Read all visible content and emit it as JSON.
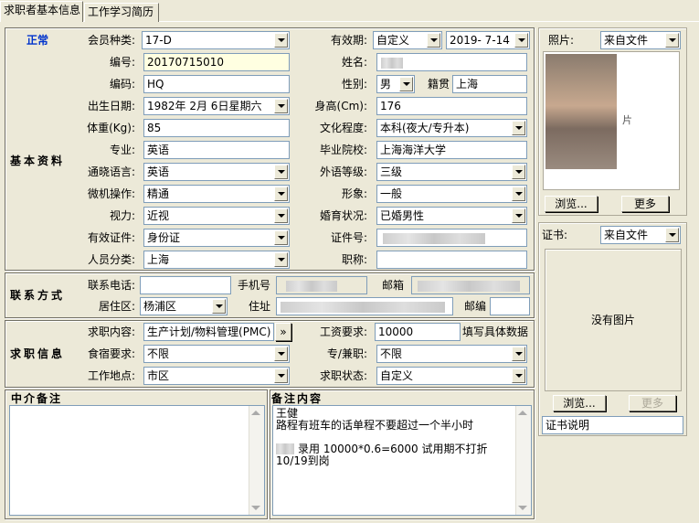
{
  "tabs": [
    "求职者基本信息",
    "工作学习简历"
  ],
  "status": "正常",
  "member_type": {
    "label": "会员种类:",
    "value": "17-D"
  },
  "validity": {
    "label": "有效期:",
    "value": "自定义",
    "date": "2019- 7-14"
  },
  "sections": {
    "basic": "基本资料",
    "contact": "联系方式",
    "job": "求职信息",
    "agent_note": "中介备注",
    "note": "备注内容"
  },
  "basic": {
    "number": {
      "label": "编号:",
      "value": "20170715010"
    },
    "name": {
      "label": "姓名:",
      "value": ""
    },
    "code": {
      "label": "编码:",
      "value": "HQ"
    },
    "gender": {
      "label": "性别:",
      "value": "男"
    },
    "native": {
      "label": "籍贯",
      "value": "上海"
    },
    "birth": {
      "label": "出生日期:",
      "value": "1982年 2月 6日星期六"
    },
    "height": {
      "label": "身高(Cm):",
      "value": "176"
    },
    "weight": {
      "label": "体重(Kg):",
      "value": "85"
    },
    "education": {
      "label": "文化程度:",
      "value": "本科(夜大/专升本)"
    },
    "major": {
      "label": "专业:",
      "value": "英语"
    },
    "school": {
      "label": "毕业院校:",
      "value": "上海海洋大学"
    },
    "language": {
      "label": "通晓语言:",
      "value": "英语"
    },
    "foreign_level": {
      "label": "外语等级:",
      "value": "三级"
    },
    "computer": {
      "label": "微机操作:",
      "value": "精通"
    },
    "appearance": {
      "label": "形象:",
      "value": "一般"
    },
    "vision": {
      "label": "视力:",
      "value": "近视"
    },
    "marriage": {
      "label": "婚育状况:",
      "value": "已婚男性"
    },
    "id_type": {
      "label": "有效证件:",
      "value": "身份证"
    },
    "id_no": {
      "label": "证件号:",
      "value": ""
    },
    "category": {
      "label": "人员分类:",
      "value": "上海"
    },
    "title": {
      "label": "职称:",
      "value": ""
    }
  },
  "contact": {
    "phone": {
      "label": "联系电话:",
      "value": ""
    },
    "mobile": {
      "label": "手机号",
      "value": ""
    },
    "email": {
      "label": "邮箱",
      "value": ""
    },
    "district": {
      "label": "居住区:",
      "value": "杨浦区"
    },
    "address": {
      "label": "住址",
      "value": ""
    },
    "zip": {
      "label": "邮编",
      "value": ""
    }
  },
  "job": {
    "content": {
      "label": "求职内容:",
      "value": "生产计划/物料管理(PMC)",
      "more": "»"
    },
    "salary": {
      "label": "工资要求:",
      "value": "10000",
      "hint": "填写具体数据"
    },
    "lodging": {
      "label": "食宿要求:",
      "value": "不限"
    },
    "fulltime": {
      "label": "专/兼职:",
      "value": "不限"
    },
    "location": {
      "label": "工作地点:",
      "value": "市区"
    },
    "state": {
      "label": "求职状态:",
      "value": "自定义"
    }
  },
  "note_lines": [
    "王健",
    "路程有班车的话单程不要超过一个半小时",
    "",
    "录用 10000*0.6=6000 试用期不打折",
    "10/19到岗"
  ],
  "photo": {
    "label": "照片:",
    "source": "来自文件",
    "browse": "浏览...",
    "more": "更多",
    "cut_text": "片"
  },
  "cert": {
    "label": "证书:",
    "source": "来自文件",
    "empty": "没有图片",
    "browse": "浏览...",
    "more": "更多",
    "desc": "证书说明"
  }
}
